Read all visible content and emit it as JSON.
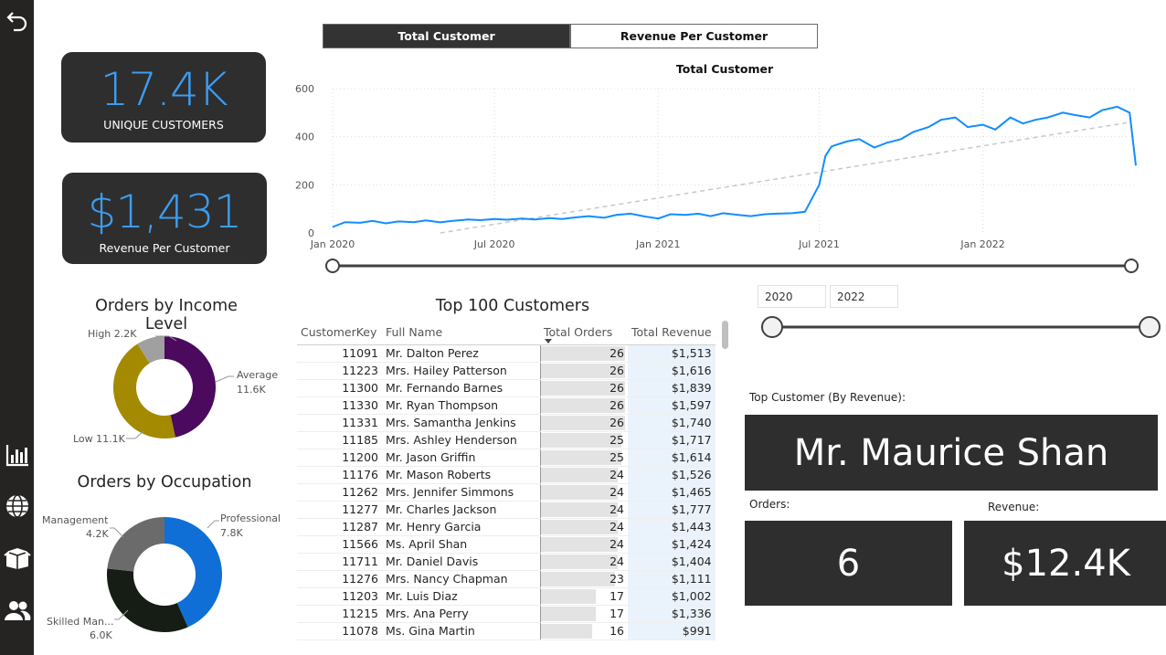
{
  "sidebar": {
    "icons": [
      "back-arrow-icon",
      "bar-chart-icon",
      "globe-icon",
      "box-icon",
      "users-icon"
    ]
  },
  "kpis": {
    "unique_customers": {
      "value": "17.4K",
      "label": "UNIQUE CUSTOMERS"
    },
    "revenue_per_customer": {
      "value": "$1,431",
      "label": "Revenue Per Customer"
    }
  },
  "toggle": {
    "total_customer": "Total Customer",
    "revenue_per_customer": "Revenue Per Customer",
    "active": "Total Customer"
  },
  "line_chart": {
    "title": "Total Customer",
    "y_ticks": [
      "600",
      "400",
      "200",
      "0"
    ],
    "x_ticks": [
      "Jan 2020",
      "Jul 2020",
      "Jan 2021",
      "Jul 2021",
      "Jan 2022"
    ],
    "colors": {
      "line": "#118DFF",
      "trend": "#c8c8c8"
    }
  },
  "chart_data": {
    "type": "line",
    "title": "Total Customer",
    "ylim": [
      0,
      600
    ],
    "x_range": [
      "2020-01",
      "2022-06"
    ],
    "series": [
      {
        "x": [
          "2020-01-01",
          "2020-01-15",
          "2020-02-01",
          "2020-02-15",
          "2020-03-01",
          "2020-03-15",
          "2020-04-01",
          "2020-04-15",
          "2020-05-01",
          "2020-05-15",
          "2020-06-01",
          "2020-06-15",
          "2020-07-01",
          "2020-07-15",
          "2020-08-01",
          "2020-08-15",
          "2020-09-01",
          "2020-09-15",
          "2020-10-01",
          "2020-10-15",
          "2020-11-01",
          "2020-11-15",
          "2020-12-01",
          "2020-12-15",
          "2021-01-01",
          "2021-01-15",
          "2021-02-01",
          "2021-02-15",
          "2021-03-01",
          "2021-03-15",
          "2021-04-01",
          "2021-04-15",
          "2021-05-01",
          "2021-05-15",
          "2021-06-01",
          "2021-06-15",
          "2021-07-01",
          "2021-07-08",
          "2021-07-15",
          "2021-08-01",
          "2021-08-15",
          "2021-09-01",
          "2021-09-15",
          "2021-10-01",
          "2021-10-15",
          "2021-11-01",
          "2021-11-15",
          "2021-12-01",
          "2021-12-15",
          "2022-01-01",
          "2022-01-15",
          "2022-02-01",
          "2022-02-15",
          "2022-03-01",
          "2022-03-15",
          "2022-04-01",
          "2022-04-15",
          "2022-05-01",
          "2022-05-15",
          "2022-06-01",
          "2022-06-15",
          "2022-06-22"
        ],
        "y": [
          25,
          45,
          42,
          50,
          40,
          48,
          45,
          52,
          44,
          50,
          56,
          53,
          58,
          55,
          60,
          56,
          62,
          58,
          65,
          70,
          63,
          75,
          80,
          70,
          60,
          78,
          75,
          80,
          70,
          82,
          75,
          70,
          78,
          80,
          82,
          88,
          200,
          320,
          360,
          380,
          390,
          355,
          375,
          390,
          420,
          440,
          470,
          480,
          440,
          450,
          430,
          480,
          455,
          470,
          480,
          500,
          490,
          480,
          510,
          525,
          500,
          280
        ]
      }
    ],
    "trend": {
      "x": [
        "2020-05-01",
        "2022-06-15"
      ],
      "y": [
        0,
        460
      ]
    },
    "grid": true
  },
  "income_donut": {
    "title": "Orders by Income Level",
    "labels": {
      "high": "High 2.2K",
      "average": "Average",
      "average_val": "11.6K",
      "low": "Low 11.1K"
    },
    "values": [
      11.6,
      11.1,
      2.2
    ],
    "colors": [
      "#4b0a5e",
      "#a38a00",
      "#a0a0a0"
    ]
  },
  "occupation_donut": {
    "title": "Orders by Occupation",
    "labels": {
      "professional": "Professional",
      "professional_val": "7.8K",
      "management": "Management",
      "management_val": "4.2K",
      "skilled": "Skilled Man...",
      "skilled_val": "6.0K"
    },
    "values": [
      7.8,
      6.0,
      4.2
    ],
    "colors": [
      "#0f6fd6",
      "#151d14",
      "#6b6b6b"
    ]
  },
  "table": {
    "title": "Top 100 Customers",
    "headers": [
      "CustomerKey",
      "Full Name",
      "Total Orders",
      "Total Revenue"
    ],
    "rows": [
      [
        "11091",
        "Mr. Dalton Perez",
        "26",
        "$1,513"
      ],
      [
        "11223",
        "Mrs. Hailey Patterson",
        "26",
        "$1,616"
      ],
      [
        "11300",
        "Mr. Fernando Barnes",
        "26",
        "$1,839"
      ],
      [
        "11330",
        "Mr. Ryan Thompson",
        "26",
        "$1,597"
      ],
      [
        "11331",
        "Mrs. Samantha Jenkins",
        "26",
        "$1,740"
      ],
      [
        "11185",
        "Mrs. Ashley Henderson",
        "25",
        "$1,717"
      ],
      [
        "11200",
        "Mr. Jason Griffin",
        "25",
        "$1,614"
      ],
      [
        "11176",
        "Mr. Mason Roberts",
        "24",
        "$1,526"
      ],
      [
        "11262",
        "Mrs. Jennifer Simmons",
        "24",
        "$1,465"
      ],
      [
        "11277",
        "Mr. Charles Jackson",
        "24",
        "$1,777"
      ],
      [
        "11287",
        "Mr. Henry Garcia",
        "24",
        "$1,443"
      ],
      [
        "11566",
        "Ms. April Shan",
        "24",
        "$1,424"
      ],
      [
        "11711",
        "Mr. Daniel Davis",
        "24",
        "$1,404"
      ],
      [
        "11276",
        "Mrs. Nancy Chapman",
        "23",
        "$1,111"
      ],
      [
        "11203",
        "Mr. Luis Diaz",
        "17",
        "$1,002"
      ],
      [
        "11215",
        "Mrs. Ana Perry",
        "17",
        "$1,336"
      ],
      [
        "11078",
        "Ms. Gina Martin",
        "16",
        "$991"
      ]
    ]
  },
  "date_range": {
    "start": "2020",
    "end": "2022"
  },
  "top_customer": {
    "label": "Top Customer (By Revenue):",
    "name": "Mr. Maurice Shan",
    "orders_label": "Orders:",
    "orders": "6",
    "revenue_label": "Revenue:",
    "revenue": "$12.4K"
  }
}
